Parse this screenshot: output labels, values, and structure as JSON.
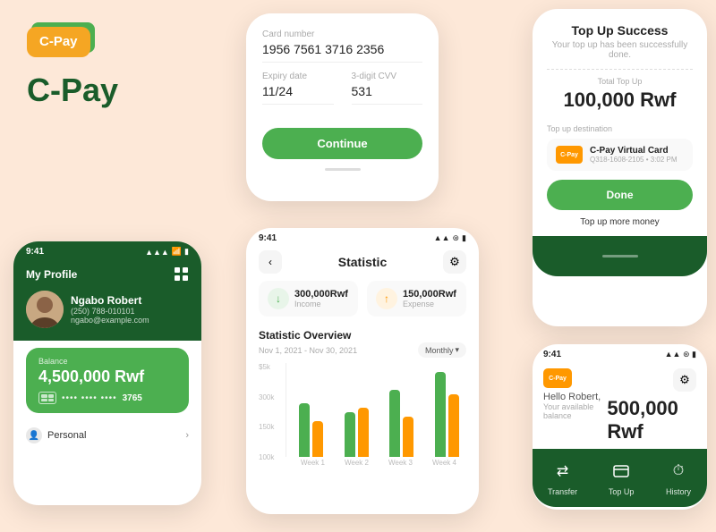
{
  "branding": {
    "logo_text": "C-Pay",
    "brand_name": "C-Pay"
  },
  "phone_profile": {
    "time": "9:41",
    "title": "My Profile",
    "user": {
      "name": "Ngabo Robert",
      "phone": "(250) 788-010101",
      "email": "ngabo@example.com"
    },
    "balance_label": "Balance",
    "balance": "4,500,000  Rwf",
    "card_dots": "•••• •••• ••••",
    "card_last4": "3765",
    "personal_label": "Personal"
  },
  "phone_card": {
    "card_number_label": "Card number",
    "card_number": "1956 7561 3716 2356",
    "expiry_label": "Expiry date",
    "expiry_value": "11/24",
    "cvv_label": "3-digit CVV",
    "cvv_value": "531",
    "continue_label": "Continue"
  },
  "phone_stat": {
    "time": "9:41",
    "title": "Statistic",
    "income_amount": "300,000Rwf",
    "income_label": "Income",
    "expense_amount": "150,000Rwf",
    "expense_label": "Expense",
    "overview_title": "Statistic Overview",
    "overview_date": "Nov 1, 2021 - Nov 30, 2021",
    "period_label": "Monthly",
    "y_labels": [
      "$5k",
      "300k",
      "150k",
      "100k"
    ],
    "weeks": [
      "Week 1",
      "Week 2",
      "Week 3",
      "Week 4"
    ],
    "bars": [
      {
        "green": 60,
        "orange": 40
      },
      {
        "green": 50,
        "orange": 55
      },
      {
        "green": 75,
        "orange": 45
      },
      {
        "green": 95,
        "orange": 70
      }
    ]
  },
  "phone_success": {
    "title": "Top Up Success",
    "subtitle": "Your top up has been successfully done.",
    "total_label": "Total Top Up",
    "total_amount": "100,000 Rwf",
    "dest_label": "Top up destination",
    "dest_name": "C-Pay Virtual Card",
    "dest_meta": "Q318-1608-2105 • 3:02 PM",
    "done_label": "Done",
    "topup_more_label": "Top up more money"
  },
  "phone_topup": {
    "time": "9:41",
    "hello_text": "Hello Robert,",
    "available_label": "Your available balance",
    "balance": "500,000 Rwf",
    "logo_text": "C-Pay",
    "actions": [
      {
        "label": "Transfer",
        "icon": "⇄"
      },
      {
        "label": "Top Up",
        "icon": "⊞"
      },
      {
        "label": "History",
        "icon": "⏱"
      }
    ]
  }
}
